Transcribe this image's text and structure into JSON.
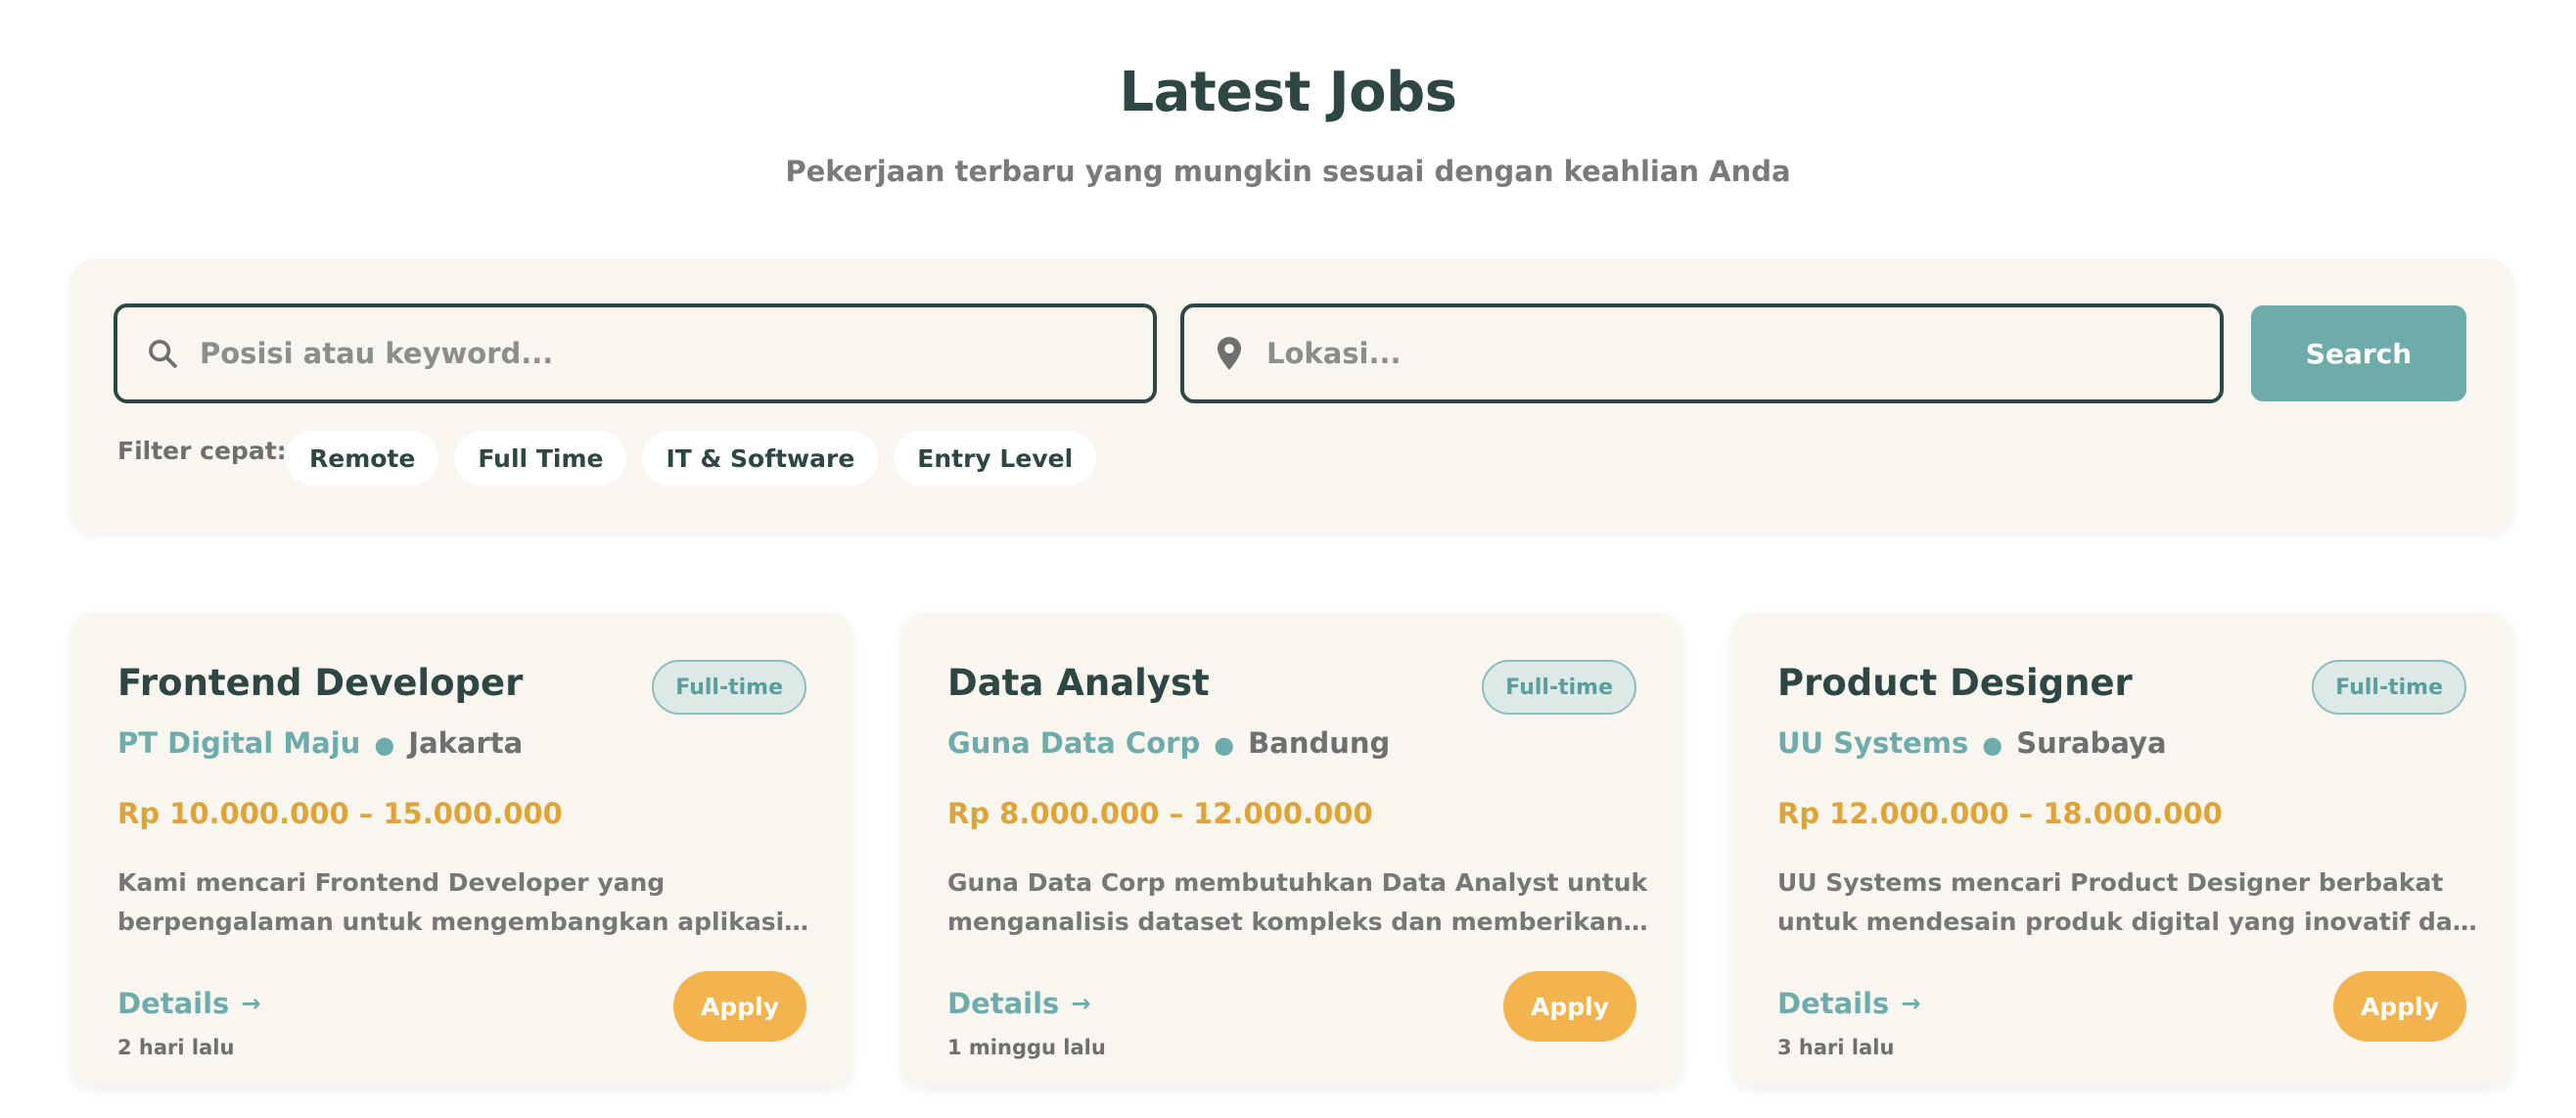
{
  "header": {
    "title": "Latest Jobs",
    "subtitle": "Pekerjaan terbaru yang mungkin sesuai dengan keahlian Anda"
  },
  "search": {
    "keyword_placeholder": "Posisi atau keyword...",
    "keyword_value": "",
    "location_placeholder": "Lokasi...",
    "location_value": "",
    "button_label": "Search",
    "filter_label": "Filter cepat:",
    "chips": [
      "Remote",
      "Full Time",
      "IT & Software",
      "Entry Level"
    ]
  },
  "jobs": [
    {
      "title": "Frontend Developer",
      "type": "Full-time",
      "company": "PT Digital Maju",
      "location": "Jakarta",
      "salary": "Rp 10.000.000 – 15.000.000",
      "description": "Kami mencari Frontend Developer yang berpengalaman untuk mengembangkan aplikasi web interaktif dengan...",
      "details_label": "Details",
      "apply_label": "Apply",
      "posted": "2 hari lalu"
    },
    {
      "title": "Data Analyst",
      "type": "Full-time",
      "company": "Guna Data Corp",
      "location": "Bandung",
      "salary": "Rp 8.000.000 – 12.000.000",
      "description": "Guna Data Corp membutuhkan Data Analyst untuk menganalisis dataset kompleks dan memberikan insight...",
      "details_label": "Details",
      "apply_label": "Apply",
      "posted": "1 minggu lalu"
    },
    {
      "title": "Product Designer",
      "type": "Full-time",
      "company": "UU Systems",
      "location": "Surabaya",
      "salary": "Rp 12.000.000 – 18.000.000",
      "description": "UU Systems mencari Product Designer berbakat untuk mendesain produk digital yang inovatif dan berfokus pa...",
      "details_label": "Details",
      "apply_label": "Apply",
      "posted": "3 hari lalu"
    }
  ],
  "colors": {
    "primary_dark": "#2e4744",
    "accent_teal": "#6eacac",
    "accent_orange": "#f3b44e",
    "salary": "#e0a33a",
    "card_bg": "#f9f6f0"
  },
  "icons": {
    "keyword": "search-icon",
    "location": "map-pin-icon",
    "details": "arrow-right-icon"
  }
}
